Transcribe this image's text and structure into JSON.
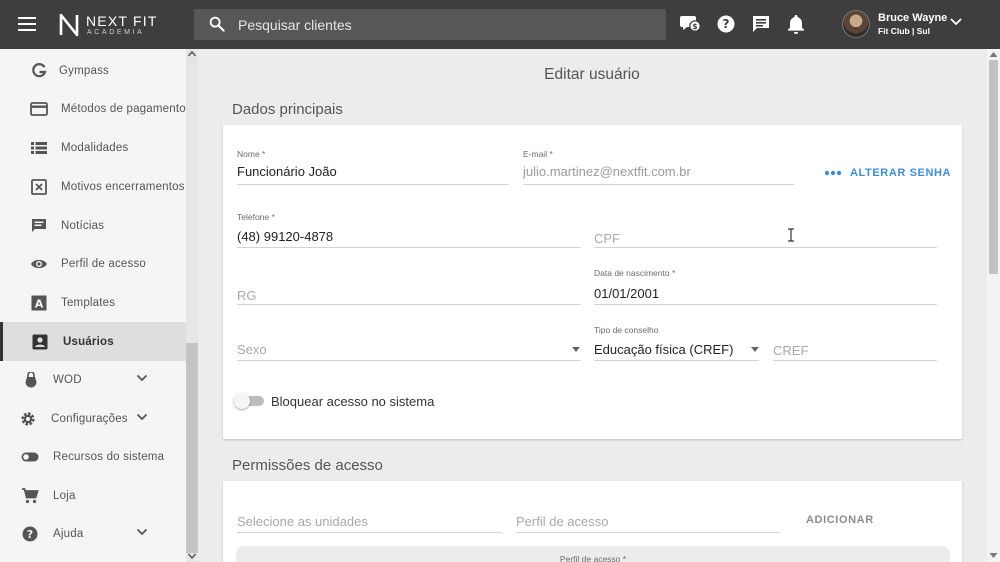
{
  "header": {
    "logo_text": "NEXT FIT",
    "logo_subtext": "ACADEMIA",
    "search_placeholder": "Pesquisar clientes",
    "user_name": "Bruce Wayne",
    "user_club": "Fit Club | Sul"
  },
  "sidebar": {
    "items": [
      {
        "label": "Gympass",
        "icon": "gympass-g-icon"
      },
      {
        "label": "Métodos de pagamento",
        "icon": "credit-card-icon"
      },
      {
        "label": "Modalidades",
        "icon": "list-icon"
      },
      {
        "label": "Motivos encerramentos",
        "icon": "close-box-icon"
      },
      {
        "label": "Notícias",
        "icon": "message-icon"
      },
      {
        "label": "Perfil de acesso",
        "icon": "eye-icon"
      },
      {
        "label": "Templates",
        "icon": "letter-a-icon"
      },
      {
        "label": "Usuários",
        "icon": "account-box-icon",
        "active": true
      },
      {
        "label": "WOD",
        "icon": "kettlebell-icon",
        "expandable": true
      },
      {
        "label": "Configurações",
        "icon": "gear-icon",
        "expandable": true
      },
      {
        "label": "Recursos do sistema",
        "icon": "toggle-icon"
      },
      {
        "label": "Loja",
        "icon": "cart-icon"
      },
      {
        "label": "Ajuda",
        "icon": "help-icon",
        "expandable": true
      }
    ]
  },
  "main": {
    "title": "Editar usuário",
    "dados": {
      "section_title": "Dados principais",
      "nome_label": "Nome *",
      "nome_value": "Funcionário João",
      "email_label": "E-mail *",
      "email_value": "julio.martinez@nextfit.com.br",
      "alter_senha_label": "ALTERAR SENHA",
      "telefone_label": "Telefone *",
      "telefone_value": "(48) 99120-4878",
      "cpf_placeholder": "CPF",
      "rg_placeholder": "RG",
      "nascimento_label": "Data de nascimento *",
      "nascimento_value": "01/01/2001",
      "sexo_placeholder": "Sexo",
      "conselho_label": "Tipo de conselho",
      "conselho_value": "Educação física (CREF)",
      "cref_placeholder": "CREF",
      "bloquear_label": "Bloquear acesso no sistema",
      "bloquear_checked": false
    },
    "permissoes": {
      "section_title": "Permissões de acesso",
      "unidades_placeholder": "Selecione as unidades",
      "perfil_placeholder": "Perfil de acesso",
      "adicionar_label": "ADICIONAR",
      "table_header_label": "Perfil de acesso *"
    }
  },
  "colors": {
    "topbar": "#3e3e3e",
    "accent": "#3d8fd4",
    "sidebar_bg": "#f5f5f5",
    "active_bg": "#dedede"
  }
}
